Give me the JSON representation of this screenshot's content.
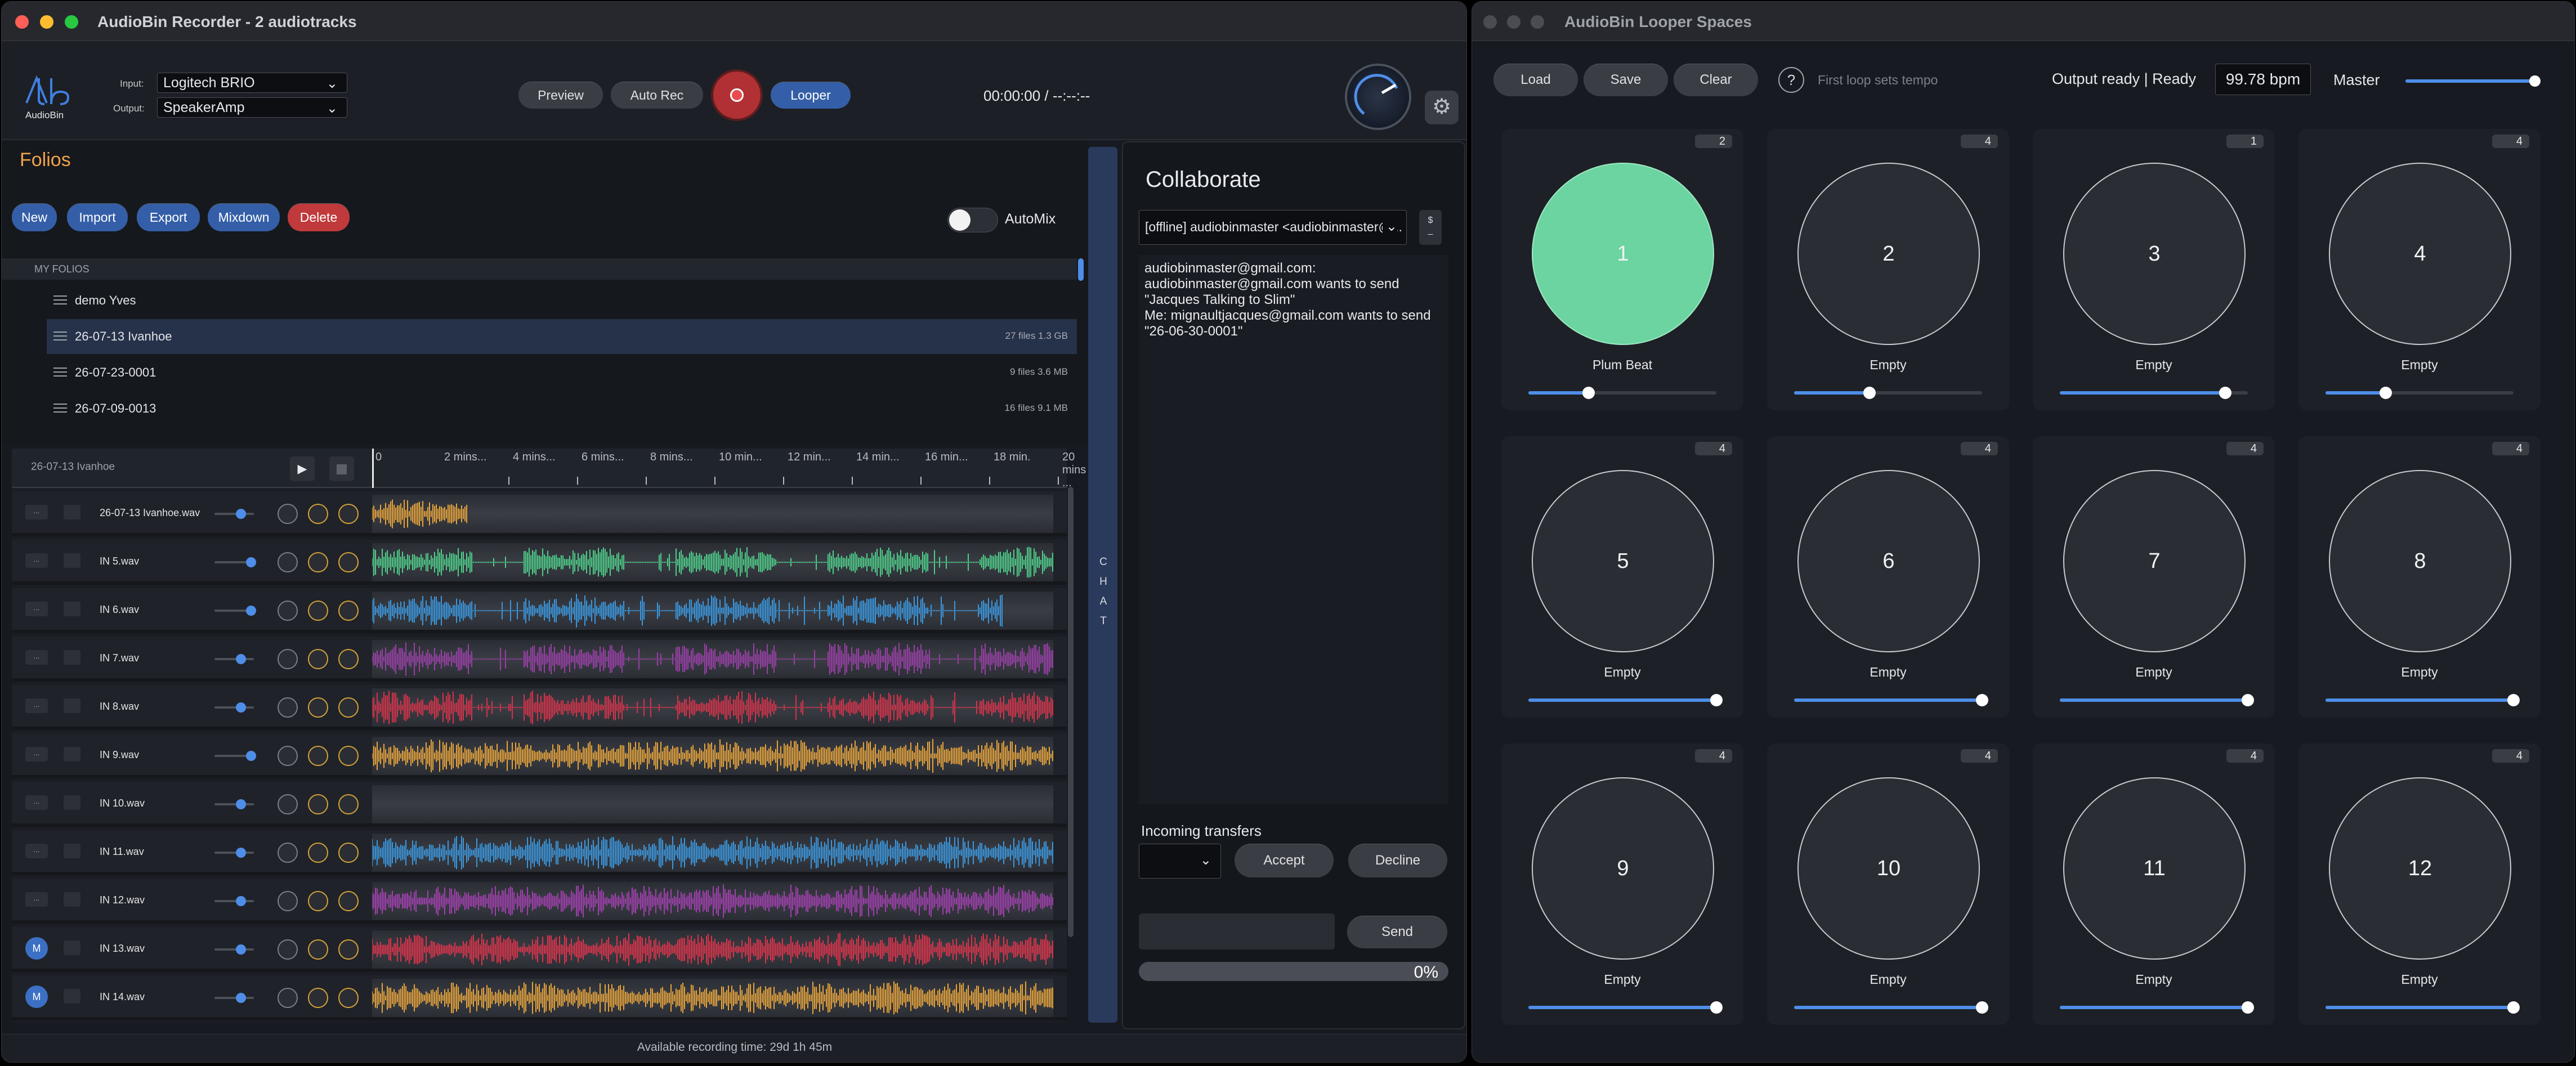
{
  "recorder": {
    "title": "AudioBin Recorder - 2 audiotracks",
    "logo_text": "AudioBin",
    "input_label": "Input:",
    "input_value": "Logitech BRIO",
    "output_label": "Output:",
    "output_value": "SpeakerAmp",
    "buttons": {
      "preview": "Preview",
      "auto_rec": "Auto Rec",
      "looper": "Looper"
    },
    "timecode": "00:00:00 / --:--:--"
  },
  "folios": {
    "title": "Folios",
    "buttons": {
      "new": "New",
      "import": "Import",
      "export": "Export",
      "mixdown": "Mixdown",
      "delete": "Delete"
    },
    "automix_label": "AutoMix",
    "automix_on": false,
    "section_header": "MY FOLIOS",
    "items": [
      {
        "name": "demo Yves",
        "meta": ""
      },
      {
        "name": "26-07-13 Ivanhoe",
        "meta": "27 files   1.3 GB"
      },
      {
        "name": "26-07-23-0001",
        "meta": "9 files   3.6 MB"
      },
      {
        "name": "26-07-09-0013",
        "meta": "16 files   9.1 MB"
      }
    ]
  },
  "tracks": {
    "current_name": "26-07-13 Ivanhoe",
    "ticks": [
      "0",
      "2 mins...",
      "4 mins...",
      "6 mins...",
      "8 mins...",
      "10 min...",
      "12 min...",
      "14 min...",
      "16 min...",
      "18 min.",
      "20 mins ..."
    ],
    "rows": [
      {
        "name": "26-07-13 Ivanhoe.wav",
        "color": "#e8a43a",
        "mute": false
      },
      {
        "name": "IN 5.wav",
        "color": "#4ecf8a",
        "mute": false
      },
      {
        "name": "IN 6.wav",
        "color": "#3a98e0",
        "mute": false
      },
      {
        "name": "IN 7.wav",
        "color": "#9a3fa8",
        "mute": false
      },
      {
        "name": "IN 8.wav",
        "color": "#d8324a",
        "mute": false
      },
      {
        "name": "IN 9.wav",
        "color": "#e8a43a",
        "mute": false
      },
      {
        "name": "IN 10.wav",
        "color": "#888888",
        "mute": false
      },
      {
        "name": "IN 11.wav",
        "color": "#3a98e0",
        "mute": false
      },
      {
        "name": "IN 12.wav",
        "color": "#a23fb0",
        "mute": false
      },
      {
        "name": "IN 13.wav",
        "color": "#e0324a",
        "mute": true
      },
      {
        "name": "IN 14.wav",
        "color": "#e8a43a",
        "mute": true
      }
    ],
    "mute_label": "M",
    "more_label": "..."
  },
  "footer": "Available recording time: 29d 1h 45m",
  "chat": {
    "tab_letters": [
      "C",
      "H",
      "A",
      "T"
    ],
    "title": "Collaborate",
    "peer_select": "[offline] audiobinmaster <audiobinmaster@...",
    "side_button": "$\n_",
    "messages": [
      "audiobinmaster@gmail.com:",
      "audiobinmaster@gmail.com wants to send",
      "\"Jacques Talking to Slim\"",
      "Me: mignaultjacques@gmail.com wants to send",
      "\"26-06-30-0001\""
    ],
    "incoming_label": "Incoming transfers",
    "accept": "Accept",
    "decline": "Decline",
    "send": "Send",
    "progress": "0%"
  },
  "looper": {
    "title": "AudioBin Looper Spaces",
    "buttons": {
      "load": "Load",
      "save": "Save",
      "clear": "Clear"
    },
    "help": "?",
    "hint": "First loop sets tempo",
    "status": "Output ready | Ready",
    "bpm": "99.78 bpm",
    "master_label": "Master",
    "pads": [
      {
        "num": "1",
        "label": "Plum Beat",
        "count": "2",
        "active": true,
        "level": 0.32
      },
      {
        "num": "2",
        "label": "Empty",
        "count": "4",
        "active": false,
        "level": 0.4
      },
      {
        "num": "3",
        "label": "Empty",
        "count": "1",
        "active": false,
        "level": 0.88
      },
      {
        "num": "4",
        "label": "Empty",
        "count": "4",
        "active": false,
        "level": 0.32
      },
      {
        "num": "5",
        "label": "Empty",
        "count": "4",
        "active": false,
        "level": 1.0
      },
      {
        "num": "6",
        "label": "Empty",
        "count": "4",
        "active": false,
        "level": 1.0
      },
      {
        "num": "7",
        "label": "Empty",
        "count": "4",
        "active": false,
        "level": 1.0
      },
      {
        "num": "8",
        "label": "Empty",
        "count": "4",
        "active": false,
        "level": 1.0
      },
      {
        "num": "9",
        "label": "Empty",
        "count": "4",
        "active": false,
        "level": 1.0
      },
      {
        "num": "10",
        "label": "Empty",
        "count": "4",
        "active": false,
        "level": 1.0
      },
      {
        "num": "11",
        "label": "Empty",
        "count": "4",
        "active": false,
        "level": 1.0
      },
      {
        "num": "12",
        "label": "Empty",
        "count": "4",
        "active": false,
        "level": 1.0
      }
    ]
  },
  "colors": {
    "accent": "#4e8ee8",
    "folio_title": "#f0a248",
    "active_pad": "#6bd4a0",
    "record": "#b03033"
  }
}
